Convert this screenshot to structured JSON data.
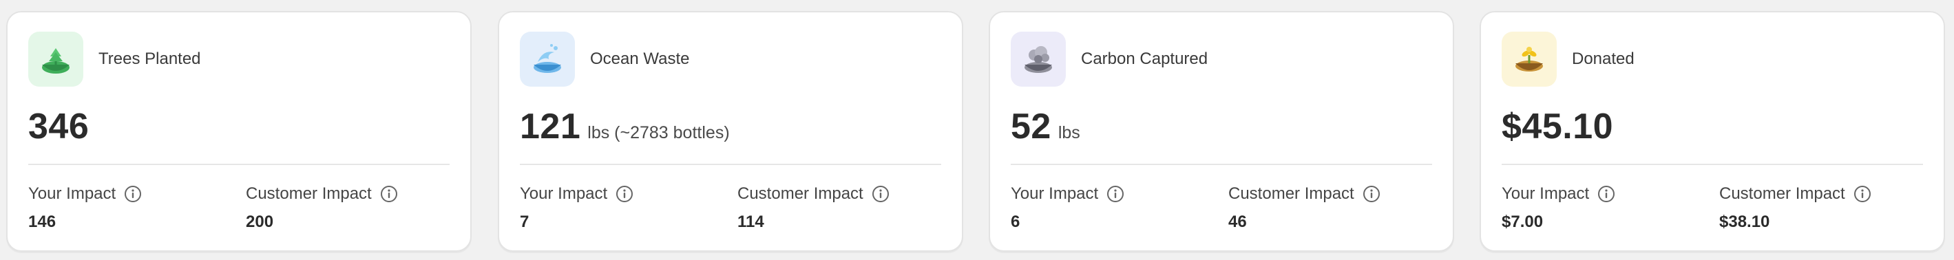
{
  "cards": [
    {
      "title": "Trees Planted",
      "icon": "tree-bowl-icon",
      "tile_color": "#e4f7e8",
      "value": "346",
      "unit": "",
      "your_impact_label": "Your Impact",
      "your_impact_value": "146",
      "customer_impact_label": "Customer Impact",
      "customer_impact_value": "200"
    },
    {
      "title": "Ocean Waste",
      "icon": "ocean-wave-icon",
      "tile_color": "#e3eefb",
      "value": "121",
      "unit": "lbs (~2783 bottles)",
      "your_impact_label": "Your Impact",
      "your_impact_value": "7",
      "customer_impact_label": "Customer Impact",
      "customer_impact_value": "114"
    },
    {
      "title": "Carbon Captured",
      "icon": "carbon-cloud-icon",
      "tile_color": "#ecebf9",
      "value": "52",
      "unit": "lbs",
      "your_impact_label": "Your Impact",
      "your_impact_value": "6",
      "customer_impact_label": "Customer Impact",
      "customer_impact_value": "46"
    },
    {
      "title": "Donated",
      "icon": "donation-bowl-icon",
      "tile_color": "#fcf5d8",
      "value": "$45.10",
      "unit": "",
      "your_impact_label": "Your Impact",
      "your_impact_value": "$7.00",
      "customer_impact_label": "Customer Impact",
      "customer_impact_value": "$38.10"
    }
  ]
}
